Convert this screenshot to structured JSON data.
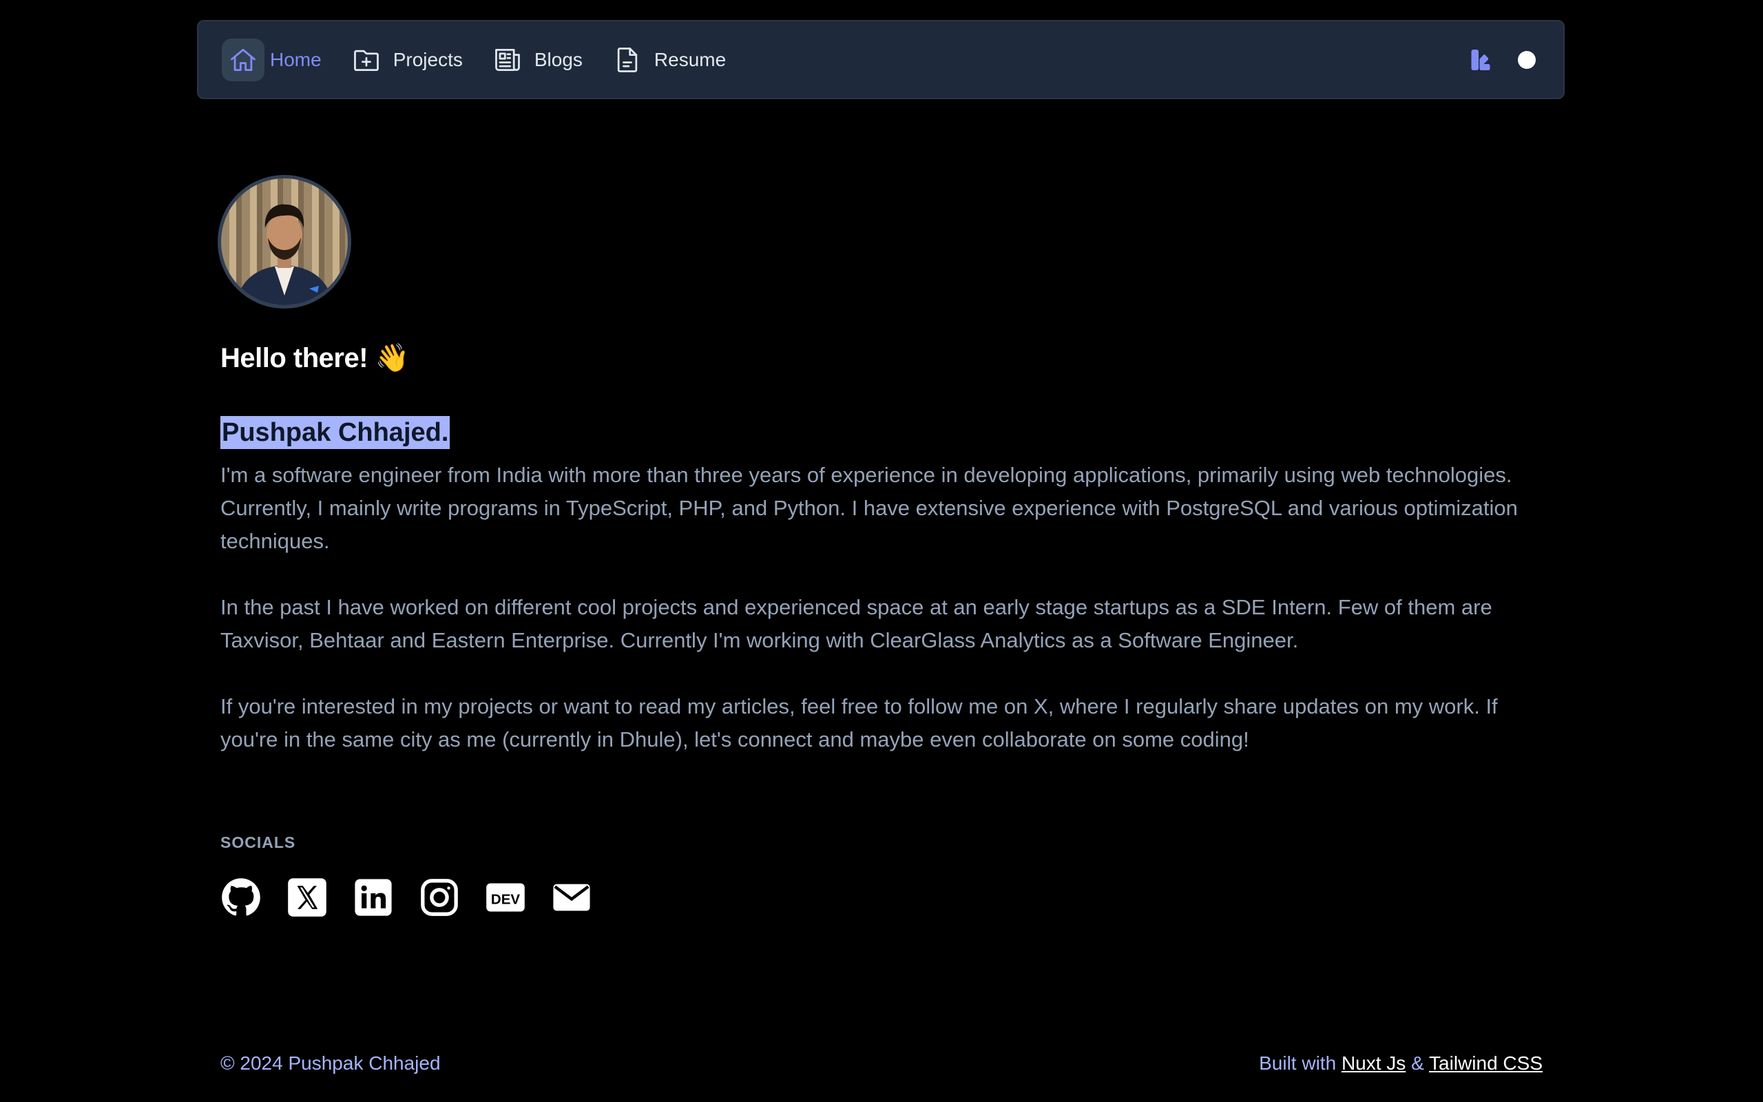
{
  "nav": {
    "items": [
      {
        "label": "Home",
        "icon": "home-icon",
        "active": true
      },
      {
        "label": "Projects",
        "icon": "folder-plus-icon",
        "active": false
      },
      {
        "label": "Blogs",
        "icon": "newspaper-icon",
        "active": false
      },
      {
        "label": "Resume",
        "icon": "document-icon",
        "active": false
      }
    ],
    "palette_icon": "palette-icon",
    "theme_icon": "theme-toggle-icon"
  },
  "profile": {
    "greeting": "Hello there! 👋",
    "name": "Pushpak Chhajed.",
    "bio": [
      "I'm a software engineer from India with more than three years of experience in developing applications, primarily using web technologies. Currently, I mainly write programs in TypeScript, PHP, and Python. I have extensive experience with PostgreSQL and various optimization techniques.",
      "In the past I have worked on different cool projects and experienced space at an early stage startups as a SDE Intern. Few of them are Taxvisor, Behtaar and Eastern Enterprise. Currently I'm working with ClearGlass Analytics as a Software Engineer.",
      "If you're interested in my projects or want to read my articles, feel free to follow me on X, where I regularly share updates on my work. If you're in the same city as me (currently in Dhule), let's connect and maybe even collaborate on some coding!"
    ]
  },
  "socials": {
    "title": "SOCIALS",
    "items": [
      "github-icon",
      "x-icon",
      "linkedin-icon",
      "instagram-icon",
      "dev-icon",
      "mail-icon"
    ],
    "dev_text": "DEV"
  },
  "footer": {
    "copyright": "© 2024 Pushpak Chhajed",
    "built_prefix": "Built with",
    "framework": "Nuxt Js",
    "separator": "&",
    "css_framework": "Tailwind CSS"
  },
  "colors": {
    "accent": "#818cf8",
    "highlight": "#a5b4fc",
    "nav_bg": "#1e293b",
    "text_muted": "#94a3b8"
  }
}
